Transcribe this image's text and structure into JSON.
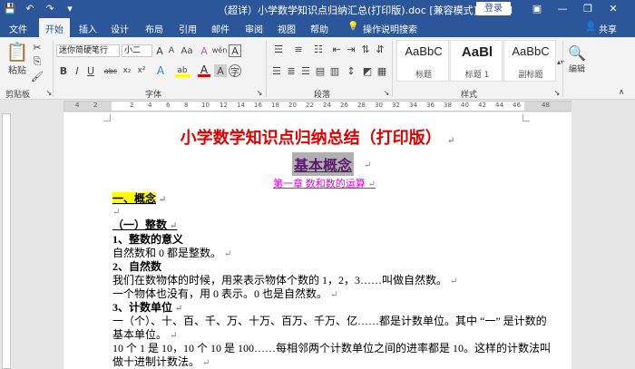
{
  "titlebar": {
    "doc_title": "（超详）小学数学知识点归纳汇总(打印版).doc [兼容模式] - Word",
    "login_label": "登录",
    "minimize": "—",
    "restore": "❐",
    "close": "✕"
  },
  "tabs": [
    "文件",
    "开始",
    "插入",
    "设计",
    "布局",
    "引用",
    "邮件",
    "审阅",
    "视图",
    "帮助"
  ],
  "tell_me": "操作说明搜索",
  "share_label": "共享",
  "ribbon": {
    "paste_label": "粘贴",
    "font_name": "迷你简硬笔行",
    "font_size": "小二",
    "grow_font": "A",
    "shrink_font": "A",
    "change_case": "Aa",
    "clear_format": "A",
    "pinyin": "wén",
    "char_border": "A",
    "bold": "B",
    "italic": "I",
    "underline": "U",
    "strike": "abc",
    "subscript": "x₂",
    "superscript": "x²",
    "text_effects": "A",
    "highlight": "ab",
    "font_color": "A",
    "char_shading": "A",
    "enclose": "字",
    "styles": [
      {
        "sample": "AaBbC",
        "name": "标题"
      },
      {
        "sample": "AaBl",
        "name": "标题 1"
      },
      {
        "sample": "AaBbC",
        "name": "副标题"
      }
    ],
    "editing_label": "编辑",
    "group_clipboard": "剪贴板",
    "group_font": "字体",
    "group_paragraph": "段落",
    "group_styles": "样式"
  },
  "ruler_numbers": [
    "4",
    "2",
    "2",
    "4",
    "6",
    "8",
    "10",
    "12",
    "14",
    "16",
    "18",
    "20",
    "22",
    "24",
    "26",
    "28",
    "30",
    "32",
    "34",
    "36",
    "38",
    "40",
    "42",
    "44",
    "46",
    "48"
  ],
  "document": {
    "title": "小学数学知识点归纳总结（打印版）",
    "heading_concept": "基本概念",
    "chapter": "第一章  数和数的运算",
    "section1": "一、概念",
    "sub1": "（一）整数",
    "item1_title": "1、整数的意义",
    "item1_text": "自然数和 0 都是整数。",
    "item2_title": "2、自然数",
    "item2_text1": "我们在数物体的时候，用来表示物体个数的 1，2，3……叫做自然数。",
    "item2_text2": "一个物体也没有，用 0 表示。0 也是自然数。",
    "item3_title": "3、计数单位",
    "item3_text1": "一（个）、十、百、千、万、十万、百万、千万、亿……都是计数单位。其中 “一” 是计数的",
    "item3_text2": "基本单位。",
    "item3_text3": "10 个 1 是 10，10 个 10 是 100……每相邻两个计数单位之间的进率都是 10。这样的计数法叫",
    "item3_text4": "做十进制计数法。",
    "para_mark": "↵"
  },
  "colors": {
    "word_blue": "#2b579a",
    "title_red": "#e00000",
    "chapter_magenta": "#e000e0",
    "highlight_yellow": "#ffff00",
    "heading_shade": "#b0b0b0"
  }
}
